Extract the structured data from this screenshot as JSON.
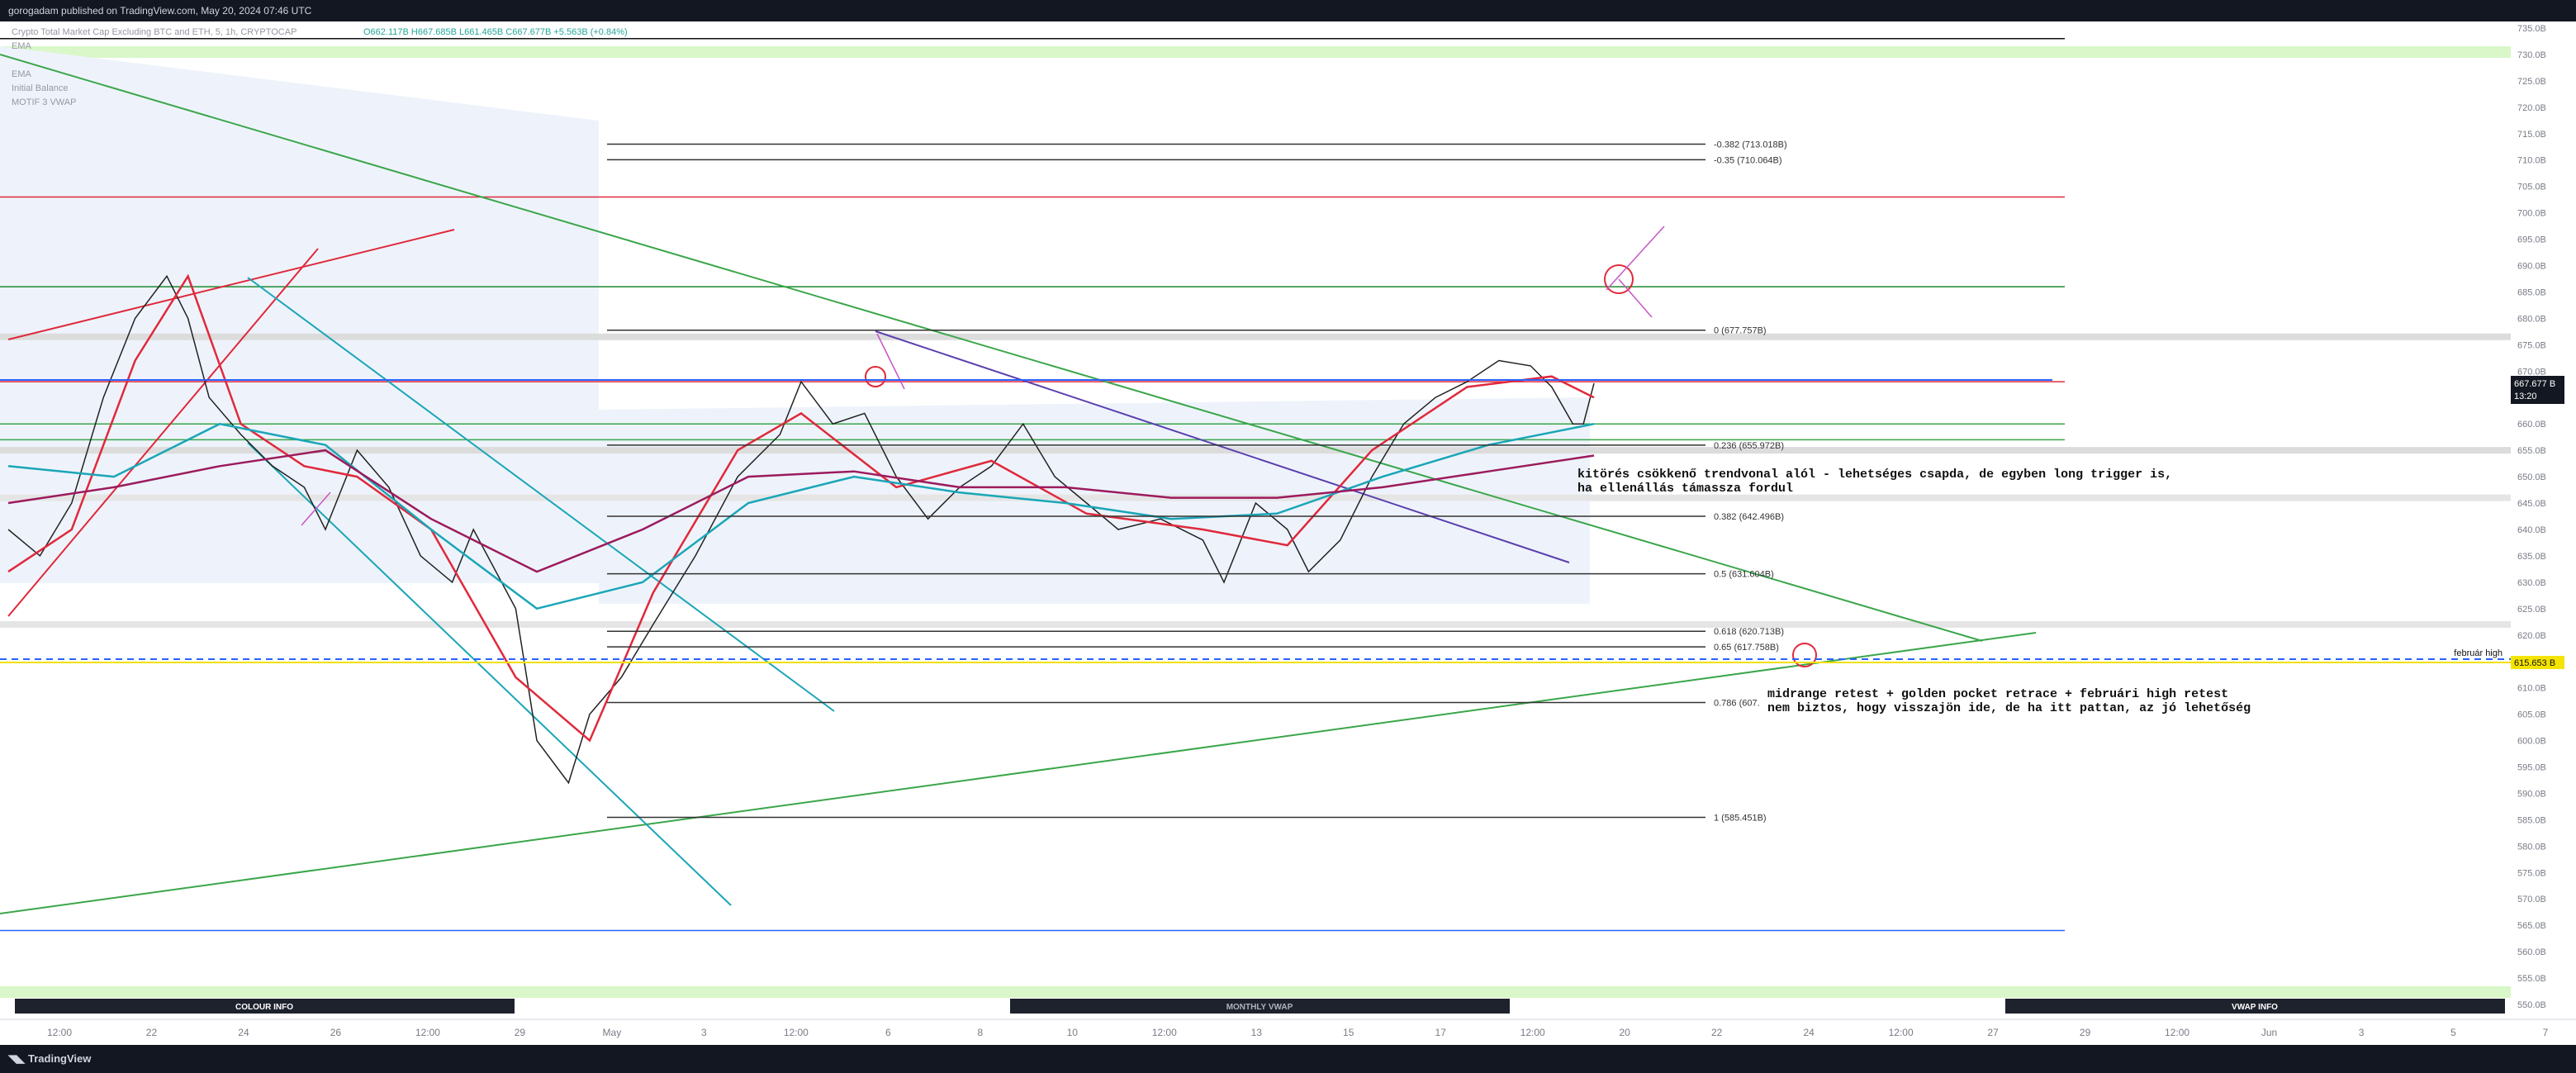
{
  "header": {
    "published_text": "gorogadam published on TradingView.com, May 20, 2024 07:46 UTC"
  },
  "legend": {
    "symbol_line": "Crypto Total Market Cap Excluding BTC and ETH, 5, 1h, CRYPTOCAP",
    "ohlc": "O662.117B H667.685B L661.465B C667.677B +5.563B (+0.84%)",
    "indicators": [
      "EMA",
      "EMA",
      "Initial Balance",
      "MOTIF 3 VWAP"
    ]
  },
  "footer": {
    "brand": "TradingView"
  },
  "chart_data": {
    "type": "line",
    "title": "Crypto Total Market Cap Excluding BTC and ETH, 5, 1h, CRYPTOCAP",
    "ylim": [
      550,
      735
    ],
    "y_ticks": [
      "550.0B",
      "555.0B",
      "560.0B",
      "565.0B",
      "570.0B",
      "575.0B",
      "580.0B",
      "585.0B",
      "590.0B",
      "595.0B",
      "600.0B",
      "605.0B",
      "610.0B",
      "615.0B",
      "620.0B",
      "625.0B",
      "630.0B",
      "635.0B",
      "640.0B",
      "645.0B",
      "650.0B",
      "655.0B",
      "660.0B",
      "665.0B",
      "670.0B",
      "675.0B",
      "680.0B",
      "685.0B",
      "690.0B",
      "695.0B",
      "700.0B",
      "705.0B",
      "710.0B",
      "715.0B",
      "720.0B",
      "725.0B",
      "730.0B",
      "735.0B"
    ],
    "x_ticks": [
      "12:00",
      "22",
      "24",
      "26",
      "12:00",
      "29",
      "May",
      "3",
      "12:00",
      "6",
      "8",
      "10",
      "12:00",
      "13",
      "15",
      "17",
      "12:00",
      "20",
      "22",
      "24",
      "12:00",
      "27",
      "29",
      "12:00",
      "Jun",
      "3",
      "5",
      "7"
    ],
    "series": [
      {
        "name": "price",
        "color": "#222222",
        "values": [
          [
            0,
            640
          ],
          [
            6,
            635
          ],
          [
            12,
            645
          ],
          [
            18,
            665
          ],
          [
            24,
            680
          ],
          [
            30,
            688
          ],
          [
            34,
            680
          ],
          [
            38,
            665
          ],
          [
            44,
            658
          ],
          [
            50,
            652
          ],
          [
            56,
            648
          ],
          [
            60,
            640
          ],
          [
            66,
            655
          ],
          [
            72,
            648
          ],
          [
            78,
            635
          ],
          [
            84,
            630
          ],
          [
            88,
            640
          ],
          [
            96,
            625
          ],
          [
            100,
            600
          ],
          [
            106,
            592
          ],
          [
            110,
            605
          ],
          [
            116,
            612
          ],
          [
            122,
            622
          ],
          [
            130,
            635
          ],
          [
            138,
            650
          ],
          [
            146,
            658
          ],
          [
            150,
            668
          ],
          [
            156,
            660
          ],
          [
            162,
            662
          ],
          [
            168,
            650
          ],
          [
            174,
            642
          ],
          [
            180,
            648
          ],
          [
            186,
            652
          ],
          [
            192,
            660
          ],
          [
            198,
            650
          ],
          [
            204,
            645
          ],
          [
            210,
            640
          ],
          [
            218,
            642
          ],
          [
            226,
            638
          ],
          [
            230,
            630
          ],
          [
            236,
            645
          ],
          [
            242,
            640
          ],
          [
            246,
            632
          ],
          [
            252,
            638
          ],
          [
            258,
            650
          ],
          [
            264,
            660
          ],
          [
            270,
            665
          ],
          [
            276,
            668
          ],
          [
            282,
            672
          ],
          [
            288,
            671
          ],
          [
            292,
            667
          ],
          [
            296,
            660
          ],
          [
            298,
            660
          ],
          [
            300,
            667.677
          ]
        ]
      },
      {
        "name": "EMA red",
        "color": "#e0293b",
        "values": [
          [
            0,
            632
          ],
          [
            12,
            640
          ],
          [
            24,
            672
          ],
          [
            34,
            688
          ],
          [
            44,
            660
          ],
          [
            56,
            652
          ],
          [
            66,
            650
          ],
          [
            80,
            640
          ],
          [
            96,
            612
          ],
          [
            110,
            600
          ],
          [
            122,
            628
          ],
          [
            138,
            655
          ],
          [
            150,
            662
          ],
          [
            168,
            648
          ],
          [
            186,
            653
          ],
          [
            204,
            643
          ],
          [
            226,
            640
          ],
          [
            242,
            637
          ],
          [
            258,
            655
          ],
          [
            276,
            667
          ],
          [
            292,
            669
          ],
          [
            300,
            665
          ]
        ]
      },
      {
        "name": "EMA cyan",
        "color": "#1aa6b7",
        "values": [
          [
            0,
            652
          ],
          [
            20,
            650
          ],
          [
            40,
            660
          ],
          [
            60,
            656
          ],
          [
            80,
            640
          ],
          [
            100,
            625
          ],
          [
            120,
            630
          ],
          [
            140,
            645
          ],
          [
            160,
            650
          ],
          [
            180,
            647
          ],
          [
            200,
            645
          ],
          [
            220,
            642
          ],
          [
            240,
            643
          ],
          [
            260,
            650
          ],
          [
            280,
            656
          ],
          [
            300,
            660
          ]
        ]
      },
      {
        "name": "VWAP purple",
        "color": "#9c1b5d",
        "values": [
          [
            0,
            645
          ],
          [
            20,
            648
          ],
          [
            40,
            652
          ],
          [
            60,
            655
          ],
          [
            80,
            642
          ],
          [
            100,
            632
          ],
          [
            120,
            640
          ],
          [
            140,
            650
          ],
          [
            160,
            651
          ],
          [
            180,
            648
          ],
          [
            200,
            648
          ],
          [
            220,
            646
          ],
          [
            240,
            646
          ],
          [
            260,
            648
          ],
          [
            280,
            651
          ],
          [
            300,
            654
          ]
        ]
      }
    ],
    "fib_levels": [
      {
        "label": "-0.382 (713.018B)",
        "value": 713.018
      },
      {
        "label": "-0.35 (710.064B)",
        "value": 710.064
      },
      {
        "label": "0 (677.757B)",
        "value": 677.757
      },
      {
        "label": "0.236 (655.972B)",
        "value": 655.972
      },
      {
        "label": "0.382 (642.496B)",
        "value": 642.496
      },
      {
        "label": "0.5 (631.604B)",
        "value": 631.604
      },
      {
        "label": "0.618 (620.713B)",
        "value": 620.713
      },
      {
        "label": "0.65 (617.758B)",
        "value": 617.758
      },
      {
        "label": "0.786 (607.",
        "value": 607.2
      },
      {
        "label": "1 (585.451B)",
        "value": 585.451
      }
    ],
    "annotations": [
      {
        "text": "kitörés csökkenő trendvonal alól - lehetséges csapda, de egyben long trigger is,"
      },
      {
        "text": "ha ellenállás támassza fordul"
      },
      {
        "text": "midrange retest + golden pocket retrace + februári high retest"
      },
      {
        "text": "nem biztos, hogy visszajön ide, de ha itt pattan, az jó lehetőség"
      }
    ],
    "markers": [
      {
        "label": "február high",
        "value": 615.653,
        "value_label": "615.653 B"
      },
      {
        "label": "667.677 B",
        "value": 667.677,
        "sub": "13:20"
      }
    ],
    "panels": [
      "COLOUR INFO",
      "MONTHLY VWAP",
      "VWAP INFO"
    ]
  }
}
